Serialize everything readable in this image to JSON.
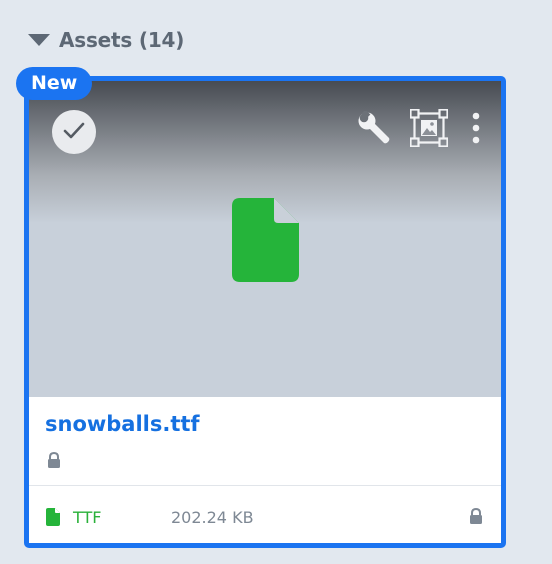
{
  "section": {
    "title": "Assets (14)",
    "collapse_icon": "caret-down-icon"
  },
  "card": {
    "badge": "New",
    "selected": true,
    "accent_color": "#1b74f1",
    "preview_icon": "file-icon",
    "preview_icon_color": "#25b43a",
    "tools": [
      "check-icon",
      "wrench-icon",
      "image-frame-icon",
      "more-vertical-icon"
    ],
    "filename": "snowballs.ttf",
    "filename_lock_icon": "lock-icon",
    "file_type": "TTF",
    "file_type_color": "#2ab13a",
    "file_size": "202.24 KB",
    "footer_lock_icon": "lock-icon"
  }
}
